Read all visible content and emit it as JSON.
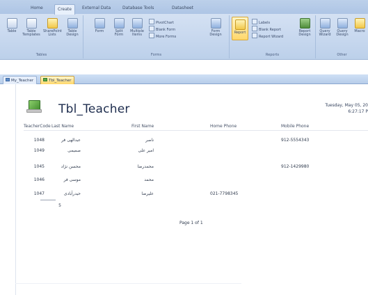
{
  "ribbon": {
    "tabs": [
      "Home",
      "Create",
      "External Data",
      "Database Tools",
      "Datasheet"
    ],
    "active_tab": 1,
    "groups": [
      {
        "label": "Tables",
        "buttons": [
          "Table",
          "Table Templates",
          "SharePoint Lists",
          "Table Design"
        ]
      },
      {
        "label": "Forms",
        "buttons": [
          "Form",
          "Split Form",
          "Multiple Items"
        ],
        "small": [
          "PivotChart",
          "Blank Form",
          "More Forms"
        ],
        "extra": "Form Design"
      },
      {
        "label": "Reports",
        "buttons": [
          "Report"
        ],
        "small": [
          "Labels",
          "Blank Report",
          "Report Wizard"
        ],
        "extra": "Report Design"
      },
      {
        "label": "Other",
        "buttons": [
          "Query Wizard",
          "Query Design",
          "Macro"
        ]
      }
    ]
  },
  "document_tabs": [
    "My_Teacher",
    "Tbl_Teacher"
  ],
  "report": {
    "title": "Tbl_Teacher",
    "date": "Tuesday, May 05, 20",
    "time": "6:27:17 P",
    "columns": [
      "TeacherCode",
      "Last Name",
      "First Name",
      "Home Phone",
      "Mobile Phone"
    ],
    "rows": [
      {
        "code": "1048",
        "last": "عبدالهی فر",
        "first": "ناصر",
        "home": "",
        "mobile": "912-5554343"
      },
      {
        "code": "1049",
        "last": "صمیمی",
        "first": "امیر علی",
        "home": "",
        "mobile": ""
      },
      {
        "code": "1045",
        "last": "محسن نژاد",
        "first": "محمدرضا",
        "home": "",
        "mobile": "912-1429980"
      },
      {
        "code": "1046",
        "last": "موسی فر",
        "first": "محمد",
        "home": "",
        "mobile": ""
      },
      {
        "code": "1047",
        "last": "حیدرآبادی",
        "first": "علیرضا",
        "home": "021-7798345",
        "mobile": ""
      }
    ],
    "total": "5",
    "page_number": "Page 1 of 1"
  }
}
